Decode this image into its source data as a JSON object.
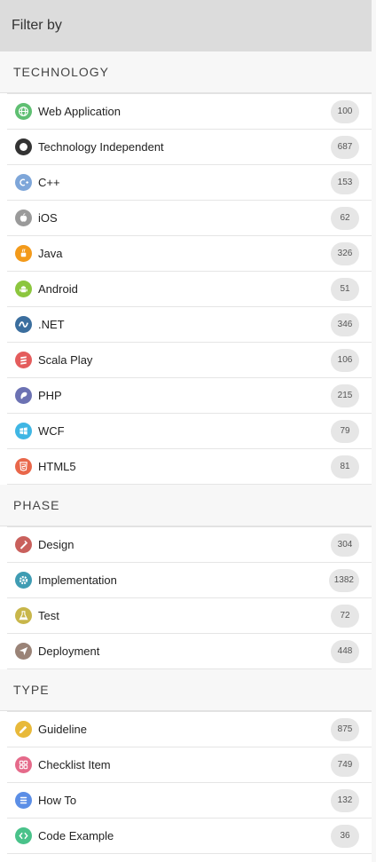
{
  "header": {
    "title": "Filter by"
  },
  "sections": [
    {
      "title": "TECHNOLOGY",
      "items": [
        {
          "label": "Web Application",
          "count": "100",
          "icon": "web-application-icon",
          "color": "#5fbf72"
        },
        {
          "label": "Technology Independent",
          "count": "687",
          "icon": "technology-independent-icon",
          "color": "#333333"
        },
        {
          "label": "C++",
          "count": "153",
          "icon": "cplusplus-icon",
          "color": "#7ea6d9"
        },
        {
          "label": "iOS",
          "count": "62",
          "icon": "apple-icon",
          "color": "#9a9a9a"
        },
        {
          "label": "Java",
          "count": "326",
          "icon": "java-icon",
          "color": "#f39a1a"
        },
        {
          "label": "Android",
          "count": "51",
          "icon": "android-icon",
          "color": "#8cc63e"
        },
        {
          "label": ".NET",
          "count": "346",
          "icon": "dotnet-icon",
          "color": "#3b6e9e"
        },
        {
          "label": "Scala Play",
          "count": "106",
          "icon": "scala-icon",
          "color": "#e45c5c"
        },
        {
          "label": "PHP",
          "count": "215",
          "icon": "php-icon",
          "color": "#6c72b3"
        },
        {
          "label": "WCF",
          "count": "79",
          "icon": "wcf-icon",
          "color": "#3fb6e4"
        },
        {
          "label": "HTML5",
          "count": "81",
          "icon": "html5-icon",
          "color": "#e9674a"
        }
      ]
    },
    {
      "title": "PHASE",
      "items": [
        {
          "label": "Design",
          "count": "304",
          "icon": "design-icon",
          "color": "#c9605c"
        },
        {
          "label": "Implementation",
          "count": "1382",
          "icon": "implementation-gear-icon",
          "color": "#3f9cb3"
        },
        {
          "label": "Test",
          "count": "72",
          "icon": "test-flask-icon",
          "color": "#c8b64a"
        },
        {
          "label": "Deployment",
          "count": "448",
          "icon": "deployment-plane-icon",
          "color": "#9a8377"
        }
      ]
    },
    {
      "title": "TYPE",
      "items": [
        {
          "label": "Guideline",
          "count": "875",
          "icon": "guideline-icon",
          "color": "#e8b93a"
        },
        {
          "label": "Checklist Item",
          "count": "749",
          "icon": "checklist-icon",
          "color": "#e56a8a"
        },
        {
          "label": "How To",
          "count": "132",
          "icon": "how-to-list-icon",
          "color": "#5b8ee6"
        },
        {
          "label": "Code Example",
          "count": "36",
          "icon": "code-example-icon",
          "color": "#49c28a"
        }
      ]
    }
  ]
}
